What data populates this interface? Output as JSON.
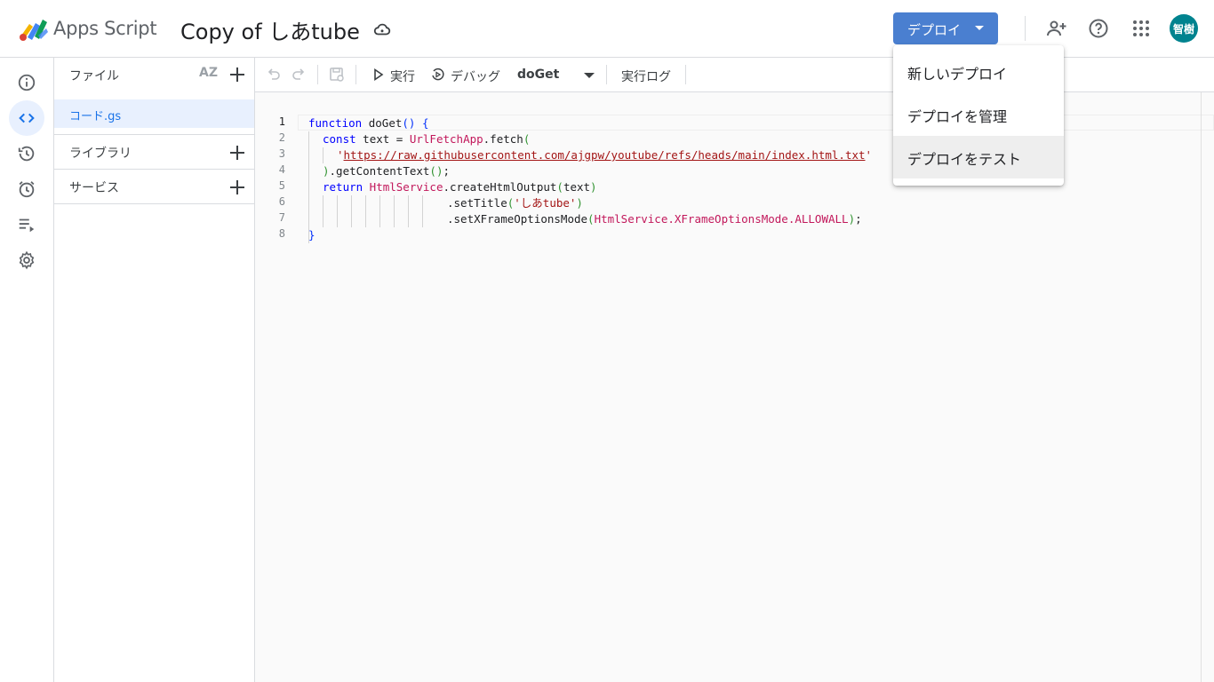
{
  "header": {
    "app_name": "Apps Script",
    "project_title": "Copy of しあtube",
    "deploy_label": "デプロイ",
    "avatar_text": "智樹"
  },
  "deploy_menu": {
    "items": [
      "新しいデプロイ",
      "デプロイを管理",
      "デプロイをテスト"
    ],
    "highlighted": "デプロイをテスト"
  },
  "sidebar": {
    "files_title": "ファイル",
    "sort_label": "AZ",
    "files": [
      "コード.gs"
    ],
    "libraries_label": "ライブラリ",
    "services_label": "サービス"
  },
  "toolbar": {
    "run_label": "実行",
    "debug_label": "デバッグ",
    "function_name": "doGet",
    "log_label": "実行ログ"
  },
  "editor": {
    "line_numbers": [
      "1",
      "2",
      "3",
      "4",
      "5",
      "6",
      "7",
      "8"
    ],
    "current_line": "1",
    "code": {
      "l1_kw": "function",
      "l1_name": " doGet",
      "l1_paren": "()",
      "l1_brace": " {",
      "l2_kw": "const",
      "l2_var": " text = ",
      "l2_cls": "UrlFetchApp",
      "l2_call": ".fetch",
      "l2_paren": "(",
      "l3_q1": "'",
      "l3_url": "https://raw.githubusercontent.com/ajgpw/youtube/refs/heads/main/index.html.txt",
      "l3_q2": "'",
      "l4_paren": ")",
      "l4_call": ".getContentText",
      "l4_paren2": "()",
      "l4_semi": ";",
      "l5_kw": "return",
      "l5_cls": " HtmlService",
      "l5_call": ".createHtmlOutput",
      "l5_p1": "(",
      "l5_arg": "text",
      "l5_p2": ")",
      "l6_call": ".setTitle",
      "l6_p1": "(",
      "l6_str": "'しあtube'",
      "l6_p2": ")",
      "l7_call": ".setXFrameOptionsMode",
      "l7_p1": "(",
      "l7_cls": "HtmlService.XFrameOptionsMode.ALLOWALL",
      "l7_p2": ")",
      "l7_semi": ";",
      "l8_brace": "}"
    }
  },
  "colors": {
    "accent": "#4a7fd0",
    "keyword": "#0000ff",
    "class": "#c2185b",
    "string": "#a31515",
    "avatar": "#00838f"
  }
}
